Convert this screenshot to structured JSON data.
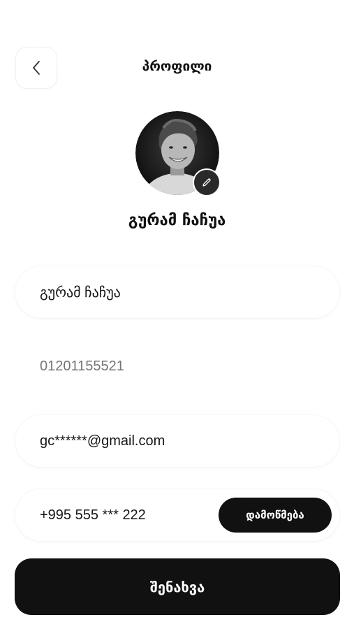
{
  "header": {
    "title": "პროფილი",
    "back_icon": "chevron-left-icon"
  },
  "profile": {
    "avatar": "avatar-photo",
    "edit_icon": "pencil-icon",
    "display_name": "გურამ ჩაჩუა"
  },
  "form": {
    "name_value": "გურამ ჩაჩუა",
    "id_placeholder": "01201155521",
    "email_value": "gc******@gmail.com",
    "phone_value": "+995 555 *** 222",
    "verify_label": "დამოწმება",
    "save_label": "შენახვა"
  },
  "colors": {
    "primary": "#111111",
    "background": "#ffffff",
    "placeholder": "#b9b9b9"
  }
}
